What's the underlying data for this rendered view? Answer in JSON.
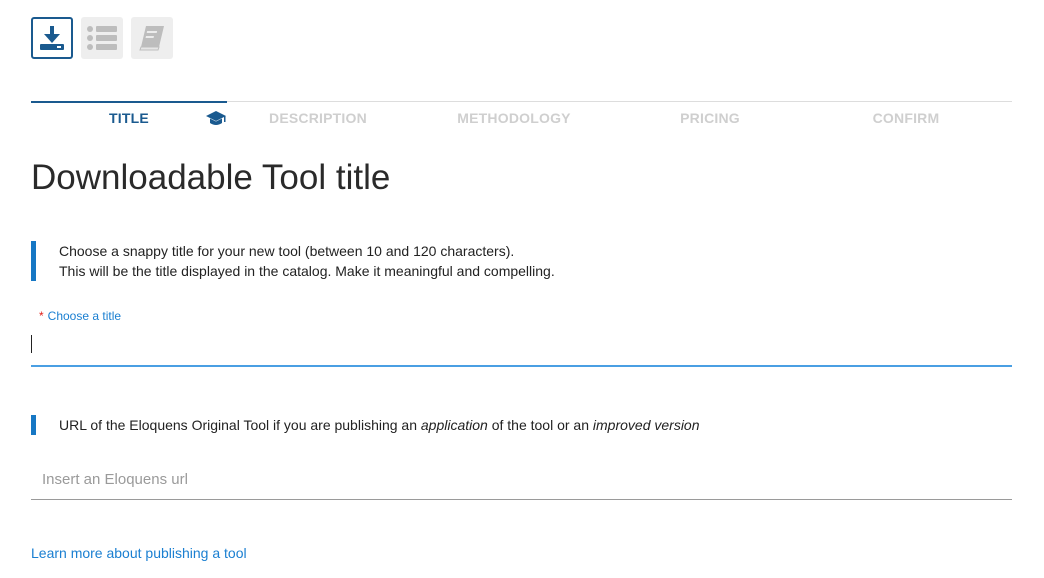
{
  "toolbar": {
    "buttons": [
      {
        "icon": "download-icon",
        "active": true
      },
      {
        "icon": "list-icon",
        "active": false
      },
      {
        "icon": "book-icon",
        "active": false
      }
    ]
  },
  "stepper": {
    "steps": [
      {
        "label": "TITLE",
        "active": true
      },
      {
        "label": "DESCRIPTION",
        "active": false
      },
      {
        "label": "METHODOLOGY",
        "active": false
      },
      {
        "label": "PRICING",
        "active": false
      },
      {
        "label": "CONFIRM",
        "active": false
      }
    ],
    "active_icon": "graduation-cap-icon"
  },
  "page_title": "Downloadable Tool title",
  "title_note": {
    "line1": "Choose a snappy title for your new tool (between 10 and 120 characters).",
    "line2": "This will be the title displayed in the catalog. Make it meaningful and compelling."
  },
  "title_field": {
    "required_mark": "*",
    "label": "Choose a title",
    "value": ""
  },
  "url_note": {
    "part1": "URL of the Eloquens Original Tool if you are publishing an ",
    "em1": "application",
    "part2": " of the tool or an ",
    "em2": "improved version"
  },
  "url_field": {
    "placeholder": "Insert an Eloquens url",
    "value": ""
  },
  "learn_more_link": "Learn more about publishing a tool",
  "colors": {
    "primary": "#1a5a8f",
    "accent": "#1677c4",
    "link": "#1a7fd1",
    "required": "#e0201a",
    "inactive_step": "#cfcfcf"
  }
}
